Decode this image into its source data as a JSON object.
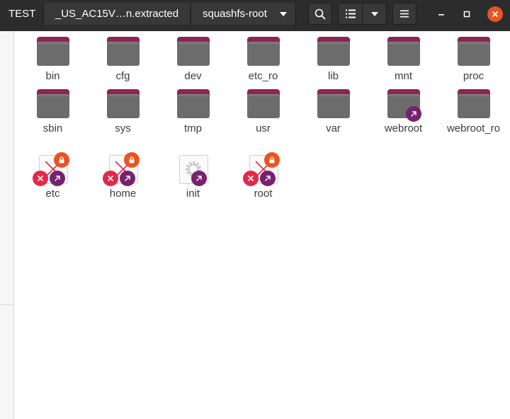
{
  "breadcrumbs": {
    "first": "TEST",
    "middle": "_US_AC15V…n.extracted",
    "current": "squashfs-root"
  },
  "colors": {
    "headerbar": "#2c2c2c",
    "folder_body": "#6c6c6c",
    "folder_tab": "#8e254f",
    "link_badge": "#77216f",
    "lock_badge": "#e95420",
    "close_button": "#e95420",
    "unreadable_badge": "#e2294a"
  },
  "toolbar": {
    "search_icon": "search-icon",
    "view_icon": "list-view-icon",
    "view_options_icon": "chevron-down-icon",
    "menu_icon": "hamburger-menu-icon"
  },
  "window": {
    "minimize_icon": "minimize-icon",
    "maximize_icon": "maximize-icon",
    "close_icon": "close-icon"
  },
  "files": [
    {
      "name": "bin",
      "kind": "folder"
    },
    {
      "name": "cfg",
      "kind": "folder"
    },
    {
      "name": "dev",
      "kind": "folder"
    },
    {
      "name": "etc_ro",
      "kind": "folder"
    },
    {
      "name": "lib",
      "kind": "folder"
    },
    {
      "name": "mnt",
      "kind": "folder"
    },
    {
      "name": "proc",
      "kind": "folder"
    },
    {
      "name": "sbin",
      "kind": "folder"
    },
    {
      "name": "sys",
      "kind": "folder"
    },
    {
      "name": "tmp",
      "kind": "folder"
    },
    {
      "name": "usr",
      "kind": "folder"
    },
    {
      "name": "var",
      "kind": "folder"
    },
    {
      "name": "webroot",
      "kind": "folder-link"
    },
    {
      "name": "webroot_ro",
      "kind": "folder"
    },
    {
      "name": "etc",
      "kind": "broken-link"
    },
    {
      "name": "home",
      "kind": "broken-link"
    },
    {
      "name": "init",
      "kind": "executable-link"
    },
    {
      "name": "root",
      "kind": "broken-link"
    }
  ]
}
